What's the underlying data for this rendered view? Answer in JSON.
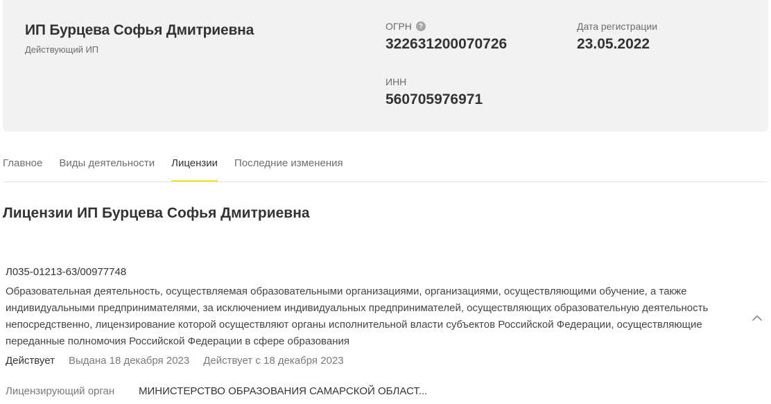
{
  "company": {
    "name": "ИП Бурцева Софья Дмитриевна",
    "status": "Действующий ИП"
  },
  "fields": {
    "ogrn_label": "ОГРН",
    "ogrn_value": "322631200070726",
    "inn_label": "ИНН",
    "inn_value": "560705976971",
    "reg_date_label": "Дата регистрации",
    "reg_date_value": "23.05.2022"
  },
  "icons": {
    "help": "question-circle-icon",
    "collapse": "chevron-up-icon"
  },
  "tabs": [
    {
      "label": "Главное",
      "active": false
    },
    {
      "label": "Виды деятельности",
      "active": false
    },
    {
      "label": "Лицензии",
      "active": true
    },
    {
      "label": "Последние изменения",
      "active": false
    }
  ],
  "section": {
    "title": "Лицензии ИП Бурцева Софья Дмитриевна"
  },
  "license": {
    "number": "Л035-01213-63/00977748",
    "description": "Образовательная деятельность, осуществляемая образовательными организациями, организациями, осуществляющими обучение, а также индивидуальными предпринимателями, за исключением индивидуальных предпринимателей, осуществляющих образовательную деятельность непосредственно, лицензирование которой осуществляют органы исполнительной власти субъектов Российской Федерации, осуществляющие переданные полномочия Российской Федерации в сфере образования",
    "status": "Действует",
    "issued": "Выдана 18 декабря 2023",
    "valid_from": "Действует с 18 декабря 2023",
    "authority_label": "Лицензирующий орган",
    "authority_value": "МИНИСТЕРСТВО ОБРАЗОВАНИЯ САМАРСКОЙ ОБЛАСТ..."
  },
  "colors": {
    "card_bg": "#f2f2f2",
    "accent": "#ffdd2d",
    "text": "#333333",
    "muted": "#6b6b6b"
  }
}
